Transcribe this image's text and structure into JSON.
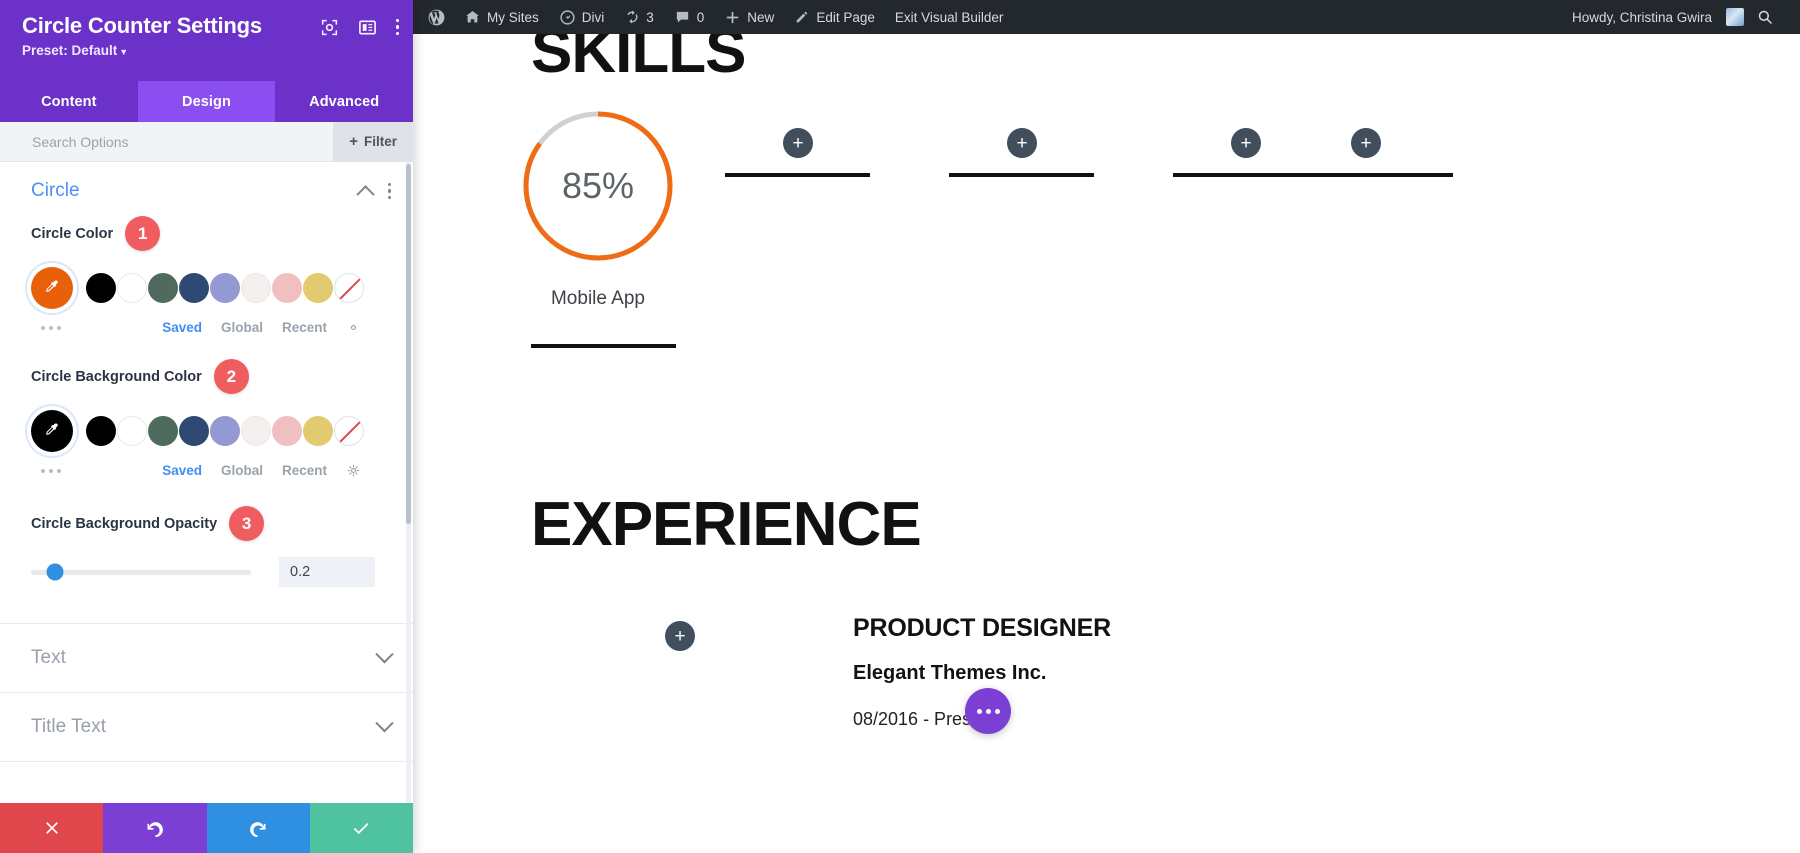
{
  "panel": {
    "title": "Circle Counter Settings",
    "preset_label": "Preset: Default",
    "header_icons": [
      "fullscreen-icon",
      "layout-panel-icon",
      "kebab-menu-icon"
    ],
    "tabs": [
      {
        "label": "Content",
        "active": false
      },
      {
        "label": "Design",
        "active": true
      },
      {
        "label": "Advanced",
        "active": false
      }
    ],
    "search": {
      "placeholder": "Search Options",
      "value": ""
    },
    "filter_button": {
      "label": "Filter",
      "plus": "+"
    },
    "sections": [
      {
        "title": "Circle",
        "open": true,
        "fields": [
          {
            "label": "Circle Color",
            "badge": "1",
            "picker_color": "#e8610a",
            "swatches": [
              "#000000",
              "#ffffff",
              "#4e6b5d",
              "#2f4a72",
              "#9499d3",
              "#f5f0ee",
              "#f0bfc2",
              "#e2ca6f",
              "none"
            ],
            "meta": {
              "saved": "Saved",
              "global": "Global",
              "recent": "Recent",
              "active": "Saved"
            }
          },
          {
            "label": "Circle Background Color",
            "badge": "2",
            "picker_color": "#000000",
            "swatches": [
              "#000000",
              "#ffffff",
              "#4e6b5d",
              "#2f4a72",
              "#9499d3",
              "#f5f0ee",
              "#f0bfc2",
              "#e2ca6f",
              "none"
            ],
            "meta": {
              "saved": "Saved",
              "global": "Global",
              "recent": "Recent",
              "active": "Saved"
            }
          },
          {
            "label": "Circle Background Opacity",
            "badge": "3",
            "value": "0.2",
            "slider_percent": 11
          }
        ]
      },
      {
        "title": "Text",
        "open": false
      },
      {
        "title": "Title Text",
        "open": false
      }
    ],
    "bottom_actions": [
      {
        "name": "cancel",
        "icon": "x-icon",
        "color": "#e0474c"
      },
      {
        "name": "undo",
        "icon": "undo-icon",
        "color": "#7b3fd4"
      },
      {
        "name": "redo",
        "icon": "redo-icon",
        "color": "#2f8fe0"
      },
      {
        "name": "save",
        "icon": "check-icon",
        "color": "#4fc2a0"
      }
    ]
  },
  "adminbar": {
    "wp_logo": "wordpress-logo-icon",
    "items": [
      {
        "label": "My Sites",
        "icon": "sites-icon"
      },
      {
        "label": "Divi",
        "icon": "divi-dashboard-icon"
      },
      {
        "label": "3",
        "icon": "updates-icon"
      },
      {
        "label": "0",
        "icon": "comments-icon"
      },
      {
        "label": "New",
        "icon": "plus-icon"
      },
      {
        "label": "Edit Page",
        "icon": "pencil-icon"
      },
      {
        "label": "Exit Visual Builder",
        "icon": ""
      }
    ],
    "howdy": "Howdy, Christina Gwira",
    "search_icon": "search-icon"
  },
  "canvas": {
    "skills_heading": "SKILLS",
    "counter": {
      "percent": "85%",
      "percent_value": 85,
      "label": "Mobile App",
      "arc_color": "#ef6c14",
      "track_color": "#cfd2d4"
    },
    "placeholder_modules": [
      {
        "plus": "+"
      },
      {
        "plus": "+"
      },
      {
        "plus": "+"
      },
      {
        "plus": "+"
      }
    ],
    "experience_heading": "EXPERIENCE",
    "job": {
      "title": "PRODUCT DESIGNER",
      "company": "Elegant Themes Inc.",
      "dates": "08/2016 - Present"
    },
    "add_module_plus": "+",
    "fab": "divi-menu-fab"
  }
}
